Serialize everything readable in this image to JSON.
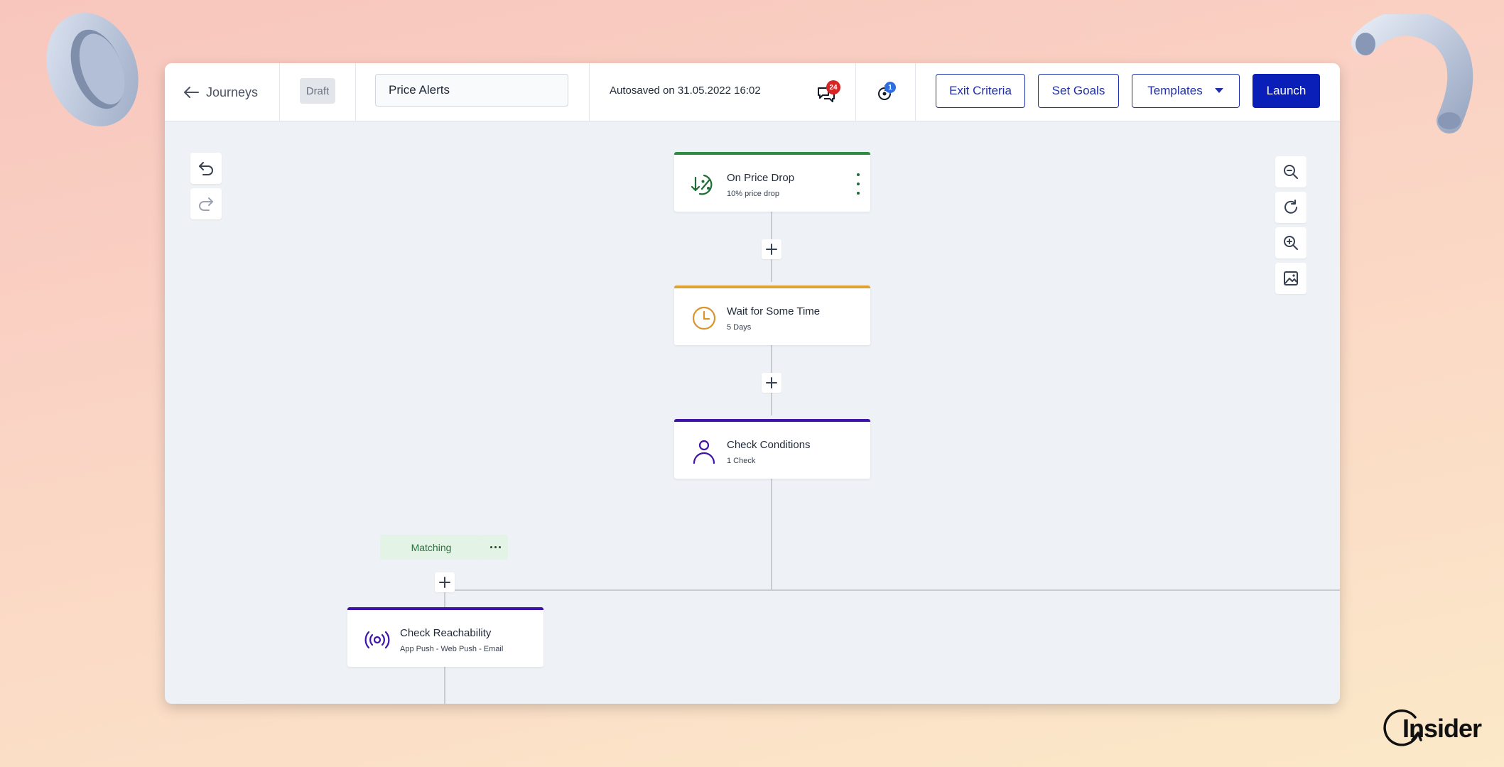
{
  "header": {
    "back_label": "Journeys",
    "status_badge": "Draft",
    "journey_name": "Price Alerts",
    "autosave_text": "Autosaved on 31.05.2022 16:02",
    "comments_count": "24",
    "notifications_count": "1",
    "buttons": {
      "exit_criteria": "Exit Criteria",
      "set_goals": "Set Goals",
      "templates": "Templates",
      "launch": "Launch"
    }
  },
  "canvas": {
    "nodes": [
      {
        "title": "On Price Drop",
        "subtitle": "10% price drop",
        "color": "#2e8b45",
        "icon": "price-drop-icon"
      },
      {
        "title": "Wait for Some Time",
        "subtitle": "5 Days",
        "color": "#e0a233",
        "icon": "clock-icon"
      },
      {
        "title": "Check Conditions",
        "subtitle": "1 Check",
        "color": "#3f12a8",
        "icon": "person-icon"
      },
      {
        "title": "Check Reachability",
        "subtitle": "App Push - Web Push - Email",
        "color": "#3f12a8",
        "icon": "broadcast-icon"
      }
    ],
    "branch_label": "Matching"
  },
  "brand": {
    "logo_text": "Insider",
    "primary_color": "#0a1fb8"
  }
}
